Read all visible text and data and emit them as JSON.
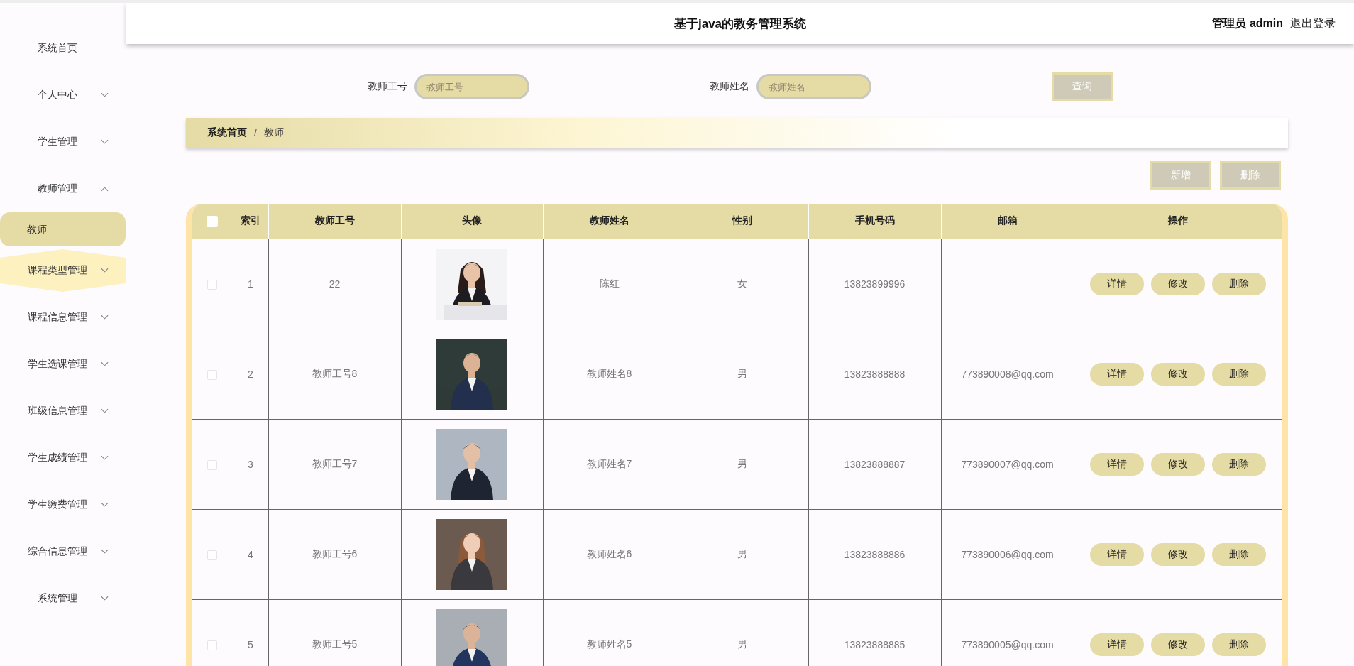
{
  "header": {
    "title": "基于java的教务管理系统",
    "user_label": "管理员 admin",
    "logout": "退出登录"
  },
  "sidebar": {
    "items": [
      {
        "label": "系统首页",
        "kind": "link",
        "selected": false,
        "hovered": false
      },
      {
        "label": "个人中心",
        "kind": "menu",
        "expanded": false,
        "hovered": false
      },
      {
        "label": "学生管理",
        "kind": "menu",
        "expanded": false,
        "hovered": false
      },
      {
        "label": "教师管理",
        "kind": "menu",
        "expanded": true,
        "hovered": false,
        "children": [
          {
            "label": "教师",
            "selected": true
          }
        ]
      },
      {
        "label": "课程类型管理",
        "kind": "menu",
        "expanded": false,
        "hovered": true
      },
      {
        "label": "课程信息管理",
        "kind": "menu",
        "expanded": false,
        "hovered": false
      },
      {
        "label": "学生选课管理",
        "kind": "menu",
        "expanded": false,
        "hovered": false
      },
      {
        "label": "班级信息管理",
        "kind": "menu",
        "expanded": false,
        "hovered": false
      },
      {
        "label": "学生成绩管理",
        "kind": "menu",
        "expanded": false,
        "hovered": false
      },
      {
        "label": "学生缴费管理",
        "kind": "menu",
        "expanded": false,
        "hovered": false
      },
      {
        "label": "综合信息管理",
        "kind": "menu",
        "expanded": false,
        "hovered": false
      },
      {
        "label": "系统管理",
        "kind": "menu",
        "expanded": false,
        "hovered": false
      }
    ]
  },
  "search": {
    "fields": [
      {
        "label": "教师工号",
        "placeholder": "教师工号"
      },
      {
        "label": "教师姓名",
        "placeholder": "教师姓名"
      }
    ],
    "button": "查询"
  },
  "breadcrumb": [
    "系统首页",
    "教师"
  ],
  "breadcrumb_separator": "/",
  "actions": [
    "新增",
    "删除"
  ],
  "table": {
    "select_all_checked": false,
    "columns": [
      "索引",
      "教师工号",
      "头像",
      "教师姓名",
      "性别",
      "手机号码",
      "邮箱",
      "操作"
    ],
    "rows": [
      {
        "checked": false,
        "index": "1",
        "id": "22",
        "name": "陈红",
        "gender": "女",
        "phone": "13823899996",
        "actions": [
          "详情",
          "修改",
          "删除"
        ]
      },
      {
        "checked": false,
        "index": "2",
        "id": "教师工号8",
        "name": "教师姓名8",
        "gender": "男",
        "phone": "13823888888",
        "email": "773890008@qq.com",
        "actions": [
          "详情",
          "修改",
          "删除"
        ]
      },
      {
        "checked": false,
        "index": "3",
        "id": "教师工号7",
        "name": "教师姓名7",
        "gender": "男",
        "phone": "13823888887",
        "email": "773890007@qq.com",
        "actions": [
          "详情",
          "修改",
          "删除"
        ]
      },
      {
        "checked": false,
        "index": "4",
        "id": "教师工号6",
        "name": "教师姓名6",
        "gender": "男",
        "phone": "13823888886",
        "email": "773890006@qq.com",
        "actions": [
          "详情",
          "修改",
          "删除"
        ]
      },
      {
        "checked": false,
        "index": "5",
        "id": "教师工号5",
        "name": "教师姓名5",
        "gender": "男",
        "phone": "13823888885",
        "email": "773890005@qq.com",
        "actions": [
          "详情",
          "修改",
          "删除"
        ]
      }
    ]
  }
}
